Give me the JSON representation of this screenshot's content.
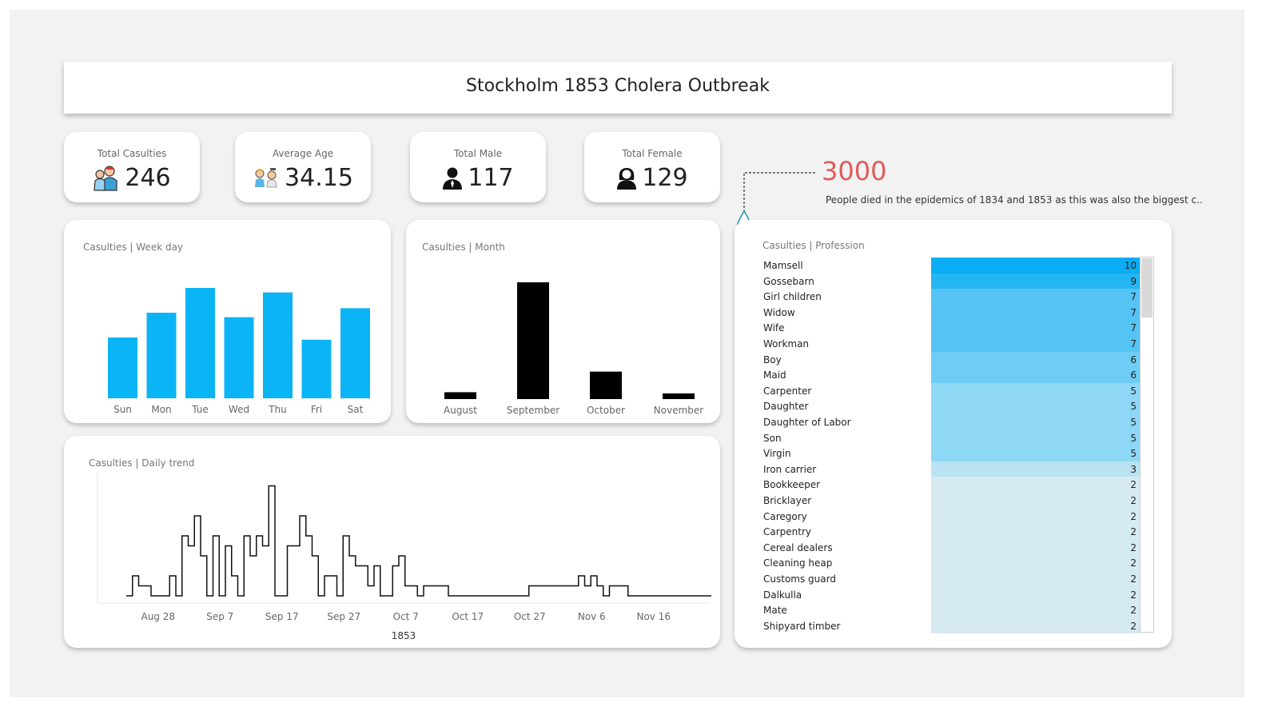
{
  "title": "Stockholm 1853 Cholera Outbreak",
  "kpis": {
    "total_casualties": {
      "label": "Total Casulties",
      "value": "246"
    },
    "average_age": {
      "label": "Average Age",
      "value": "34.15"
    },
    "total_male": {
      "label": "Total Male",
      "value": "117"
    },
    "total_female": {
      "label": "Total Female",
      "value": "129"
    }
  },
  "annotation": {
    "number": "3000",
    "text": "People died in the epidemics of 1834 and 1853 as this was also the biggest c.."
  },
  "colors": {
    "bar_blue": "#0bb4f5",
    "bar_black": "#000000",
    "accent_red": "#e05a5a"
  },
  "chart_data": [
    {
      "type": "bar",
      "title": "Casulties | Week day",
      "categories": [
        "Sun",
        "Mon",
        "Tue",
        "Wed",
        "Thu",
        "Fri",
        "Sat"
      ],
      "values": [
        27,
        38,
        49,
        36,
        47,
        26,
        40
      ]
    },
    {
      "type": "bar",
      "title": "Casulties | Month",
      "categories": [
        "August",
        "September",
        "October",
        "November"
      ],
      "values": [
        6,
        102,
        24,
        5
      ]
    },
    {
      "type": "line",
      "title": "Casulties | Daily trend",
      "xlabel": "1853",
      "x_ticks": [
        "Aug 28",
        "Sep 7",
        "Sep 17",
        "Sep 27",
        "Oct 7",
        "Oct 17",
        "Oct 27",
        "Nov 6",
        "Nov 16"
      ],
      "x": [
        "Aug 23",
        "Aug 24",
        "Aug 25",
        "Aug 26",
        "Aug 27",
        "Aug 28",
        "Aug 29",
        "Aug 30",
        "Aug 31",
        "Sep 1",
        "Sep 2",
        "Sep 3",
        "Sep 4",
        "Sep 5",
        "Sep 6",
        "Sep 7",
        "Sep 8",
        "Sep 9",
        "Sep 10",
        "Sep 11",
        "Sep 12",
        "Sep 13",
        "Sep 14",
        "Sep 15",
        "Sep 16",
        "Sep 17",
        "Sep 18",
        "Sep 19",
        "Sep 20",
        "Sep 21",
        "Sep 22",
        "Sep 23",
        "Sep 24",
        "Sep 25",
        "Sep 26",
        "Sep 27",
        "Sep 28",
        "Sep 29",
        "Sep 30",
        "Oct 1",
        "Oct 2",
        "Oct 3",
        "Oct 4",
        "Oct 5",
        "Oct 6",
        "Oct 7",
        "Oct 8",
        "Oct 9",
        "Oct 10",
        "Oct 11",
        "Oct 12",
        "Oct 13",
        "Oct 14",
        "Oct 15",
        "Oct 16",
        "Oct 17",
        "Oct 18",
        "Oct 19",
        "Oct 20",
        "Oct 21",
        "Oct 22",
        "Oct 23",
        "Oct 24",
        "Oct 25",
        "Oct 26",
        "Oct 27",
        "Oct 28",
        "Oct 29",
        "Oct 30",
        "Oct 31",
        "Nov 1",
        "Nov 2",
        "Nov 3",
        "Nov 4",
        "Nov 5",
        "Nov 6",
        "Nov 7",
        "Nov 8",
        "Nov 9",
        "Nov 10",
        "Nov 11",
        "Nov 12",
        "Nov 13",
        "Nov 14",
        "Nov 15",
        "Nov 16",
        "Nov 17",
        "Nov 18",
        "Nov 19",
        "Nov 20",
        "Nov 21",
        "Nov 22",
        "Nov 23",
        "Nov 24",
        "Nov 25",
        "Nov 26",
        "Nov 27",
        "Nov 28",
        "Nov 29",
        "Nov 30"
      ],
      "values": [
        0,
        2,
        1,
        1,
        0,
        0,
        0,
        2,
        0,
        6,
        5,
        8,
        4,
        0,
        6,
        0,
        5,
        2,
        0,
        6,
        4,
        6,
        5,
        11,
        0,
        0,
        5,
        5,
        8,
        6,
        4,
        0,
        2,
        2,
        0,
        6,
        4,
        3,
        3,
        1,
        3,
        0,
        0,
        3,
        4,
        1,
        1,
        0,
        1,
        1,
        1,
        1,
        0,
        0,
        0,
        0,
        0,
        0,
        0,
        0,
        0,
        0,
        0,
        0,
        0,
        1,
        1,
        1,
        1,
        1,
        1,
        1,
        1,
        2,
        1,
        2,
        1,
        0,
        1,
        1,
        1,
        0,
        0,
        0,
        0,
        0,
        0,
        0,
        0,
        0,
        0,
        0,
        0,
        0,
        0,
        0,
        0,
        0,
        0,
        0
      ]
    },
    {
      "type": "table",
      "title": "Casulties | Profession",
      "rows": [
        {
          "name": "Mamsell",
          "value": 10
        },
        {
          "name": "Gossebarn",
          "value": 9
        },
        {
          "name": "Girl children",
          "value": 7
        },
        {
          "name": "Widow",
          "value": 7
        },
        {
          "name": "Wife",
          "value": 7
        },
        {
          "name": "Workman",
          "value": 7
        },
        {
          "name": "Boy",
          "value": 6
        },
        {
          "name": "Maid",
          "value": 6
        },
        {
          "name": "Carpenter",
          "value": 5
        },
        {
          "name": "Daughter",
          "value": 5
        },
        {
          "name": "Daughter of Labor",
          "value": 5
        },
        {
          "name": "Son",
          "value": 5
        },
        {
          "name": "Virgin",
          "value": 5
        },
        {
          "name": "Iron carrier",
          "value": 3
        },
        {
          "name": "Bookkeeper",
          "value": 2
        },
        {
          "name": "Bricklayer",
          "value": 2
        },
        {
          "name": "Caregory",
          "value": 2
        },
        {
          "name": "Carpentry",
          "value": 2
        },
        {
          "name": "Cereal dealers",
          "value": 2
        },
        {
          "name": "Cleaning heap",
          "value": 2
        },
        {
          "name": "Customs guard",
          "value": 2
        },
        {
          "name": "Dalkulla",
          "value": 2
        },
        {
          "name": "Mate",
          "value": 2
        },
        {
          "name": "Shipyard timber",
          "value": 2
        }
      ]
    }
  ]
}
